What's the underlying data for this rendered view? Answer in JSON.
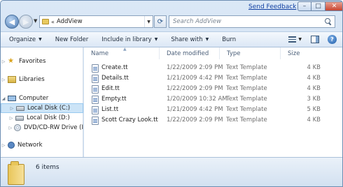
{
  "window": {
    "send_feedback": "Send Feedback",
    "caption_buttons": {
      "minimize": "–",
      "maximize": "□",
      "close": "✕"
    }
  },
  "address": {
    "breadcrumb_chevron": "«",
    "path": "AddView",
    "search_placeholder": "Search AddView"
  },
  "toolbar": {
    "items": [
      {
        "label": "Organize",
        "dropdown": true
      },
      {
        "label": "New Folder",
        "dropdown": false
      },
      {
        "label": "Include in library",
        "dropdown": true
      },
      {
        "label": "Share with",
        "dropdown": true
      },
      {
        "label": "Burn",
        "dropdown": false
      }
    ],
    "help_label": "?"
  },
  "nav": {
    "items": [
      {
        "label": "Favorites",
        "icon": "star-icon",
        "expander": "▷",
        "indent": 0,
        "selected": false
      },
      {
        "label": "Libraries",
        "icon": "library-icon",
        "expander": "▷",
        "indent": 0,
        "selected": false
      },
      {
        "label": "Computer",
        "icon": "computer-icon",
        "expander": "◢",
        "indent": 0,
        "selected": false
      },
      {
        "label": "Local Disk (C:)",
        "icon": "hard-disk-icon",
        "expander": "▷",
        "indent": 1,
        "selected": true
      },
      {
        "label": "Local Disk (D:)",
        "icon": "hard-disk-icon",
        "expander": "▷",
        "indent": 1,
        "selected": false
      },
      {
        "label": "DVD/CD-RW Drive (I",
        "icon": "dvd-drive-icon",
        "expander": "▷",
        "indent": 1,
        "selected": false
      },
      {
        "label": "Network",
        "icon": "network-icon",
        "expander": "▷",
        "indent": 0,
        "selected": false
      }
    ]
  },
  "columns": {
    "name": "Name",
    "date": "Date modified",
    "type": "Type",
    "size": "Size"
  },
  "files": [
    {
      "name": "Create.tt",
      "date": "1/22/2009 2:09 PM",
      "type": "Text Template",
      "size": "4 KB"
    },
    {
      "name": "Details.tt",
      "date": "1/21/2009 4:42 PM",
      "type": "Text Template",
      "size": "4 KB"
    },
    {
      "name": "Edit.tt",
      "date": "1/22/2009 2:09 PM",
      "type": "Text Template",
      "size": "4 KB"
    },
    {
      "name": "Empty.tt",
      "date": "1/20/2009 10:32 AM",
      "type": "Text Template",
      "size": "3 KB"
    },
    {
      "name": "List.tt",
      "date": "1/21/2009 4:42 PM",
      "type": "Text Template",
      "size": "5 KB"
    },
    {
      "name": "Scott Crazy Look.tt",
      "date": "1/22/2009 2:09 PM",
      "type": "Text Template",
      "size": "4 KB"
    }
  ],
  "status": {
    "items_count": "6 items"
  }
}
